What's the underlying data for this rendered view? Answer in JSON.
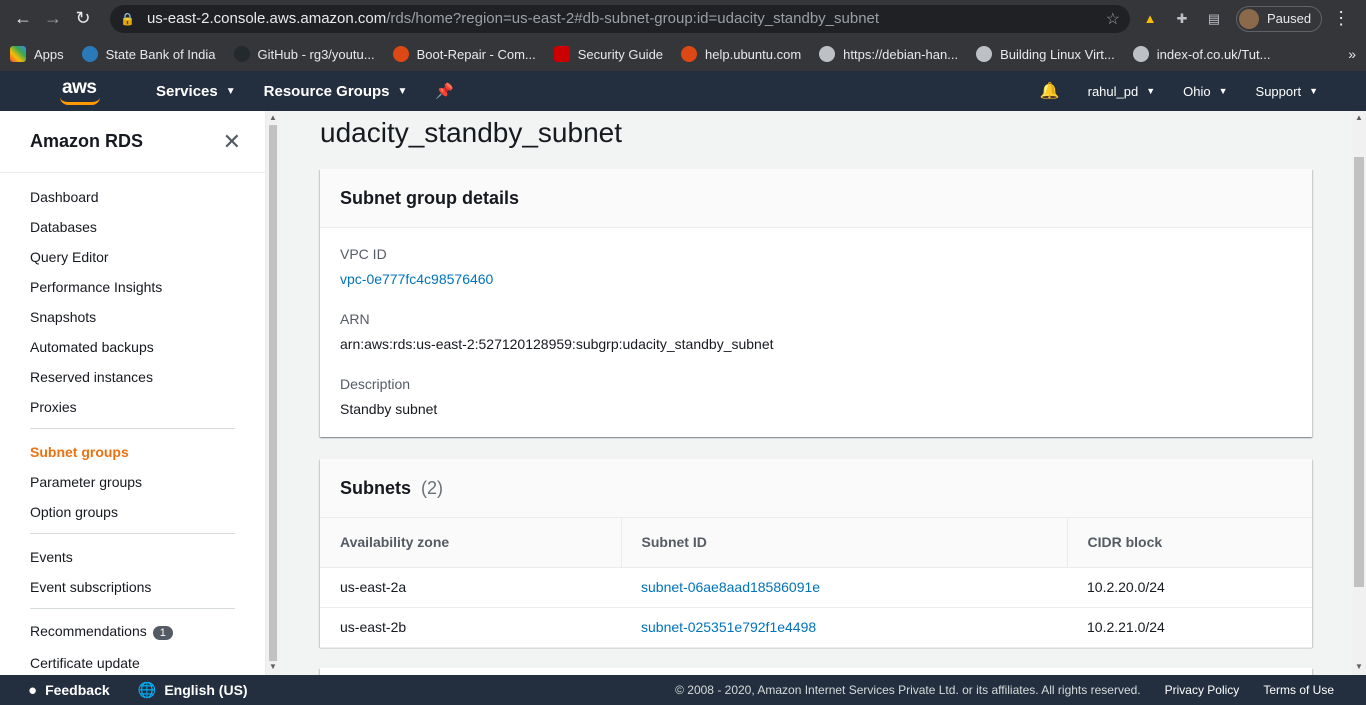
{
  "browser": {
    "url_host": "us-east-2.console.aws.amazon.com",
    "url_path": "/rds/home?region=us-east-2#db-subnet-group:id=udacity_standby_subnet",
    "profile_label": "Paused",
    "bookmarks": [
      {
        "label": "Apps",
        "color": "#e8453c"
      },
      {
        "label": "State Bank of India",
        "color": "#2a7ab9"
      },
      {
        "label": "GitHub - rg3/youtu...",
        "color": "#24292e"
      },
      {
        "label": "Boot-Repair - Com...",
        "color": "#dd4814"
      },
      {
        "label": "Security Guide",
        "color": "#cc0000"
      },
      {
        "label": "help.ubuntu.com",
        "color": "#dd4814"
      },
      {
        "label": "https://debian-han...",
        "color": "#9aa0a6"
      },
      {
        "label": "Building Linux Virt...",
        "color": "#9aa0a6"
      },
      {
        "label": "index-of.co.uk/Tut...",
        "color": "#9aa0a6"
      }
    ]
  },
  "awsnav": {
    "logo": "aws",
    "services": "Services",
    "resource_groups": "Resource Groups",
    "user": "rahul_pd",
    "region": "Ohio",
    "support": "Support"
  },
  "sidebar": {
    "title": "Amazon RDS",
    "items": [
      "Dashboard",
      "Databases",
      "Query Editor",
      "Performance Insights",
      "Snapshots",
      "Automated backups",
      "Reserved instances",
      "Proxies",
      "Subnet groups",
      "Parameter groups",
      "Option groups",
      "Events",
      "Event subscriptions",
      "Recommendations",
      "Certificate update"
    ],
    "recommendations_badge": "1"
  },
  "page": {
    "title": "udacity_standby_subnet"
  },
  "details": {
    "title": "Subnet group details",
    "vpc_label": "VPC ID",
    "vpc_value": "vpc-0e777fc4c98576460",
    "arn_label": "ARN",
    "arn_value": "arn:aws:rds:us-east-2:527120128959:subgrp:udacity_standby_subnet",
    "desc_label": "Description",
    "desc_value": "Standby subnet"
  },
  "subnets": {
    "title": "Subnets",
    "count": "(2)",
    "columns": [
      "Availability zone",
      "Subnet ID",
      "CIDR block"
    ],
    "rows": [
      [
        "us-east-2a",
        "subnet-06ae8aad18586091e",
        "10.2.20.0/24"
      ],
      [
        "us-east-2b",
        "subnet-025351e792f1e4498",
        "10.2.21.0/24"
      ]
    ]
  },
  "footer": {
    "feedback": "Feedback",
    "language": "English (US)",
    "copyright": "© 2008 - 2020, Amazon Internet Services Private Ltd. or its affiliates. All rights reserved.",
    "privacy": "Privacy Policy",
    "terms": "Terms of Use"
  }
}
